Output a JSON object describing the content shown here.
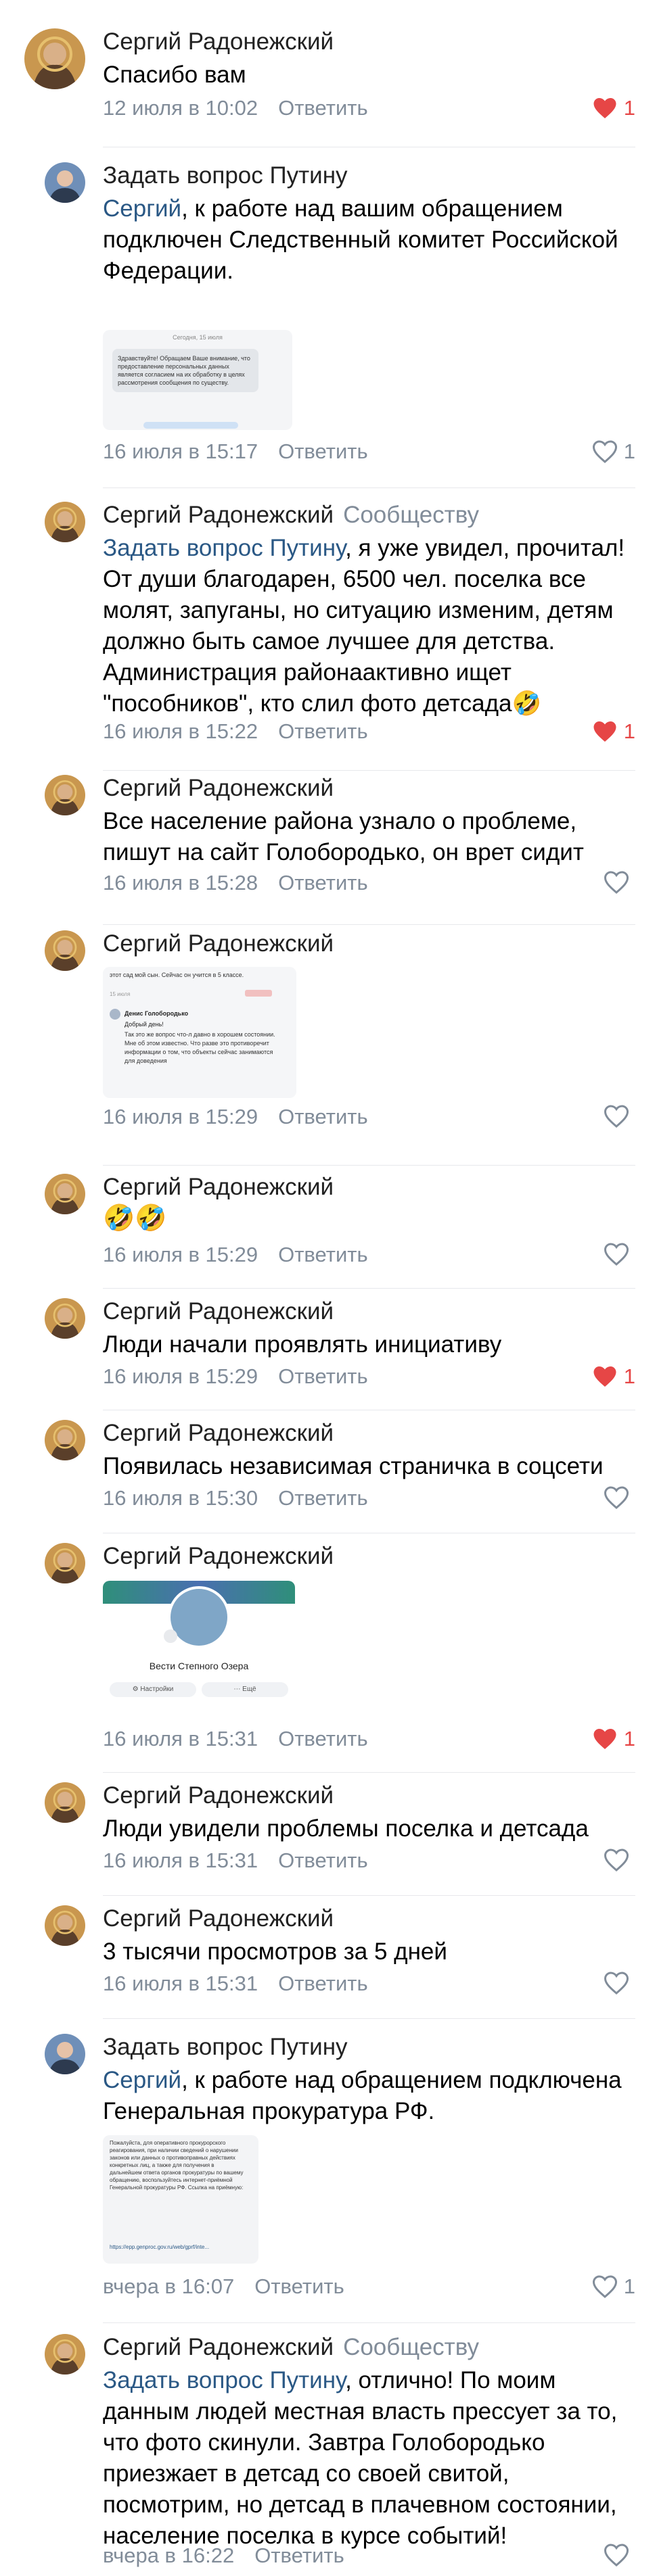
{
  "comments": [
    {
      "author": "Сергий Радонежский",
      "tag": "",
      "text": "Спасибо вам",
      "mention": "",
      "time": "12 июля в 10:02",
      "reply": "Ответить",
      "likes": "1",
      "liked": true,
      "avatar": "saint-icon"
    },
    {
      "author": "Задать вопрос Путину",
      "tag": "",
      "mention": "Сергий",
      "text": ", к работе над вашим обращением подключен Следственный комитет Российской Федерации.",
      "time": "16 июля в 15:17",
      "reply": "Ответить",
      "likes": "1",
      "liked": false,
      "avatar": "putin-icon"
    },
    {
      "author": "Сергий Радонежский",
      "tag": "Сообществу",
      "mention": "Задать вопрос Путину",
      "text": ", я уже увидел, прочитал! От души благодарен, 6500 чел. поселка все молят, запуганы, но ситуацию изменим, детям должно быть самое лучшее для детства. Администрация районаактивно ищет \"пособников\", кто слил фото детсада🤣",
      "time": "16 июля в 15:22",
      "reply": "Ответить",
      "likes": "1",
      "liked": true,
      "avatar": "saint-icon"
    },
    {
      "author": "Сергий Радонежский",
      "tag": "",
      "mention": "",
      "text": "Все население района узнало  о проблеме, пишут на сайт Голобородько, он врет сидит",
      "time": "16 июля в 15:28",
      "reply": "Ответить",
      "likes": "",
      "liked": false,
      "avatar": "saint-icon"
    },
    {
      "author": "Сергий Радонежский",
      "tag": "",
      "mention": "",
      "text": "",
      "time": "16 июля в 15:29",
      "reply": "Ответить",
      "likes": "",
      "liked": false,
      "avatar": "saint-icon"
    },
    {
      "author": "Сергий Радонежский",
      "tag": "",
      "mention": "",
      "text": "🤣🤣",
      "time": "16 июля в 15:29",
      "reply": "Ответить",
      "likes": "",
      "liked": false,
      "avatar": "saint-icon"
    },
    {
      "author": "Сергий Радонежский",
      "tag": "",
      "mention": "",
      "text": "Люди начали проявлять инициативу",
      "time": "16 июля в 15:29",
      "reply": "Ответить",
      "likes": "1",
      "liked": true,
      "avatar": "saint-icon"
    },
    {
      "author": "Сергий Радонежский",
      "tag": "",
      "mention": "",
      "text": "Появилась независимая страничка в соцсети",
      "time": "16 июля в 15:30",
      "reply": "Ответить",
      "likes": "",
      "liked": false,
      "avatar": "saint-icon"
    },
    {
      "author": "Сергий Радонежский",
      "tag": "",
      "mention": "",
      "text": "",
      "time": "16 июля в 15:31",
      "reply": "Ответить",
      "likes": "1",
      "liked": true,
      "avatar": "saint-icon"
    },
    {
      "author": "Сергий Радонежский",
      "tag": "",
      "mention": "",
      "text": "Люди увидели проблемы поселка и детсада",
      "time": "16 июля в 15:31",
      "reply": "Ответить",
      "likes": "",
      "liked": false,
      "avatar": "saint-icon"
    },
    {
      "author": "Сергий Радонежский",
      "tag": "",
      "mention": "",
      "text": "3 тысячи просмотров за 5 дней",
      "time": "16 июля в 15:31",
      "reply": "Ответить",
      "likes": "",
      "liked": false,
      "avatar": "saint-icon"
    },
    {
      "author": "Задать вопрос Путину",
      "tag": "",
      "mention": "Сергий",
      "text": ", к работе над обращением подключена Генеральная прокуратура РФ.",
      "time": "вчера в 16:07",
      "reply": "Ответить",
      "likes": "1",
      "liked": false,
      "avatar": "putin-icon"
    },
    {
      "author": "Сергий Радонежский",
      "tag": "Сообществу",
      "mention": "Задать вопрос Путину",
      "text": ", отлично! По моим данным людей местная власть прессует за то, что фото скинули. Завтра Голобородько приезжает в детсад со своей свитой, посмотрим, но детсад в плачевном состоянии, население поселка в курсе событий!",
      "time": "вчера в 16:22",
      "reply": "Ответить",
      "likes": "",
      "liked": false,
      "avatar": "saint-icon"
    }
  ],
  "attachments": {
    "sk": {
      "date": "Сегодня, 15 июля",
      "msg": "Здравствуйте! Обращаем Ваше внимание, что предоставление персональных данных является согласием на их обработку в целях рассмотрения сообщения по существу."
    },
    "chat": {
      "line1": "этот сад мой сын. Сейчас он учится в 5 классе.",
      "time": "15 июля",
      "name": "Денис Голобородько",
      "greet": "Добрый день!",
      "body": "Так это же вопрос что-л давно в хорошем состоянии. Мне об этом известно. Что разве это противоречит информации о том, что объекты сейчас занимаются для доведения"
    },
    "group": {
      "name": "Вести Степного Озера",
      "btn1": "Настройки",
      "btn2": "Ещё"
    },
    "gp": {
      "msg": "Пожалуйста, для оперативного прокурорского реагирования, при наличии сведений о нарушении законов или данных о противоправных действиях конкретных лиц, а также для получения в дальнейшем ответа органов прокуратуры по вашему обращению, воспользуйтесь интернет-приёмной Генеральной прокуратуры РФ. Ссылка на приёмную:",
      "link": "https://epp.genproc.gov.ru/web/gprf/inte..."
    }
  },
  "colors": {
    "accent": "#2a5885",
    "muted": "#818c99",
    "like": "#e64646"
  }
}
